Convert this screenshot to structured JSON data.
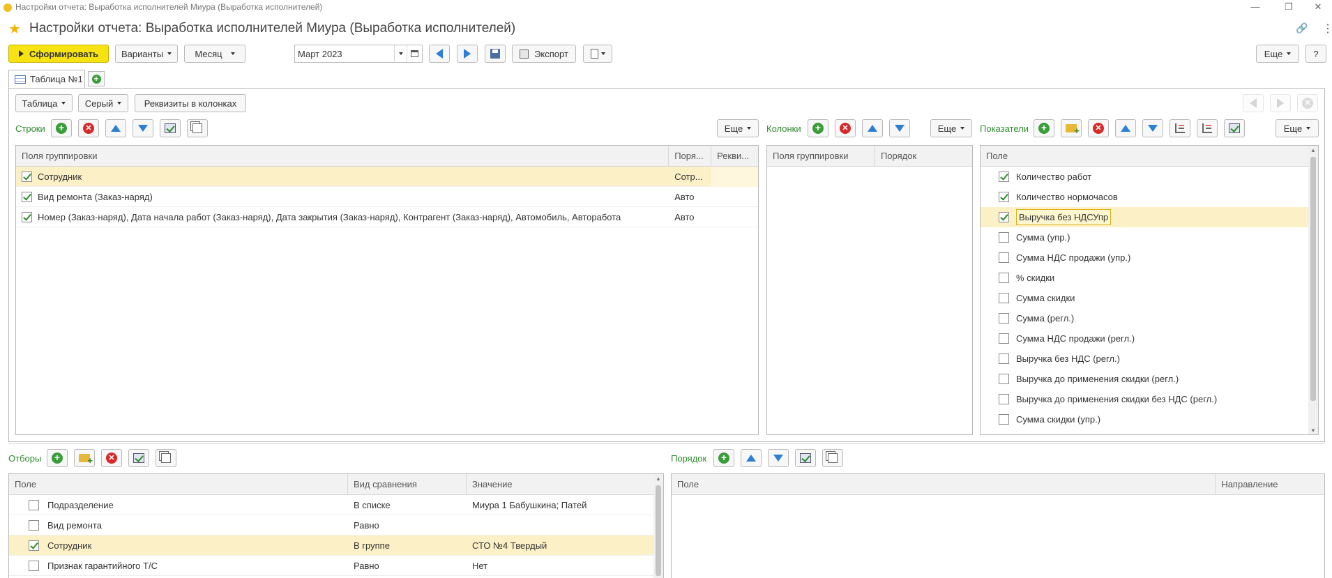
{
  "window": {
    "title": "Настройки отчета: Выработка исполнителей Миура (Выработка исполнителей)",
    "minimize": "—",
    "restore": "❐",
    "close": "✕"
  },
  "header": {
    "title": "Настройки отчета: Выработка исполнителей Миура (Выработка исполнителей)",
    "link_icon": "🔗",
    "menu_icon": "⋮"
  },
  "toolbar": {
    "generate": "Сформировать",
    "variants": "Варианты",
    "period": "Месяц",
    "date_value": "Март 2023",
    "expert": "Экспорт",
    "more": "Еще",
    "help": "?"
  },
  "tabs": [
    {
      "label": "Таблица №1"
    }
  ],
  "structure_toolbar": {
    "table": "Таблица",
    "style": "Серый",
    "details_in_columns": "Реквизиты в колонках"
  },
  "rows_section": {
    "label": "Строки",
    "more": "Еще",
    "columns": [
      "Поля группировки",
      "Поря...",
      "Рекви..."
    ],
    "items": [
      {
        "checked": true,
        "name": "Сотрудник",
        "order": "Сотр...",
        "details": "",
        "selected": true
      },
      {
        "checked": true,
        "name": "Вид ремонта (Заказ-наряд)",
        "order": "Авто",
        "details": "",
        "selected": false
      },
      {
        "checked": true,
        "name": "Номер (Заказ-наряд), Дата начала работ (Заказ-наряд), Дата закрытия (Заказ-наряд), Контрагент (Заказ-наряд), Автомобиль, Авторабота",
        "order": "Авто",
        "details": "",
        "selected": false
      }
    ]
  },
  "columns_section": {
    "label": "Колонки",
    "more": "Еще",
    "columns": [
      "Поля группировки",
      "Порядок"
    ]
  },
  "indicators_section": {
    "label": "Показатели",
    "more": "Еще",
    "columns": [
      "Поле"
    ],
    "items": [
      {
        "checked": true,
        "name": "Количество работ",
        "selected": false
      },
      {
        "checked": true,
        "name": "Количество нормочасов",
        "selected": false
      },
      {
        "checked": true,
        "name": "Выручка без НДСУпр",
        "selected": true
      },
      {
        "checked": false,
        "name": "Сумма (упр.)",
        "selected": false
      },
      {
        "checked": false,
        "name": "Сумма НДС продажи (упр.)",
        "selected": false
      },
      {
        "checked": false,
        "name": "% скидки",
        "selected": false
      },
      {
        "checked": false,
        "name": "Сумма скидки",
        "selected": false
      },
      {
        "checked": false,
        "name": "Сумма (регл.)",
        "selected": false
      },
      {
        "checked": false,
        "name": "Сумма НДС продажи (регл.)",
        "selected": false
      },
      {
        "checked": false,
        "name": "Выручка без НДС (регл.)",
        "selected": false
      },
      {
        "checked": false,
        "name": "Выручка до применения скидки (регл.)",
        "selected": false
      },
      {
        "checked": false,
        "name": "Выручка до применения скидки без НДС (регл.)",
        "selected": false
      },
      {
        "checked": false,
        "name": "Сумма скидки (упр.)",
        "selected": false
      }
    ]
  },
  "filters_section": {
    "label": "Отборы",
    "columns": [
      "Поле",
      "Вид сравнения",
      "Значение"
    ],
    "items": [
      {
        "checked": false,
        "field": "Подразделение",
        "comparison": "В списке",
        "value": "Миура 1 Бабушкина; Патей",
        "selected": false
      },
      {
        "checked": false,
        "field": "Вид ремонта",
        "comparison": "Равно",
        "value": "",
        "selected": false
      },
      {
        "checked": true,
        "field": "Сотрудник",
        "comparison": "В группе",
        "value": "СТО №4 Твердый",
        "selected": true
      },
      {
        "checked": false,
        "field": "Признак гарантийного Т/С",
        "comparison": "Равно",
        "value": "Нет",
        "selected": false
      }
    ]
  },
  "order_section": {
    "label": "Порядок",
    "columns": [
      "Поле",
      "Направление"
    ]
  }
}
